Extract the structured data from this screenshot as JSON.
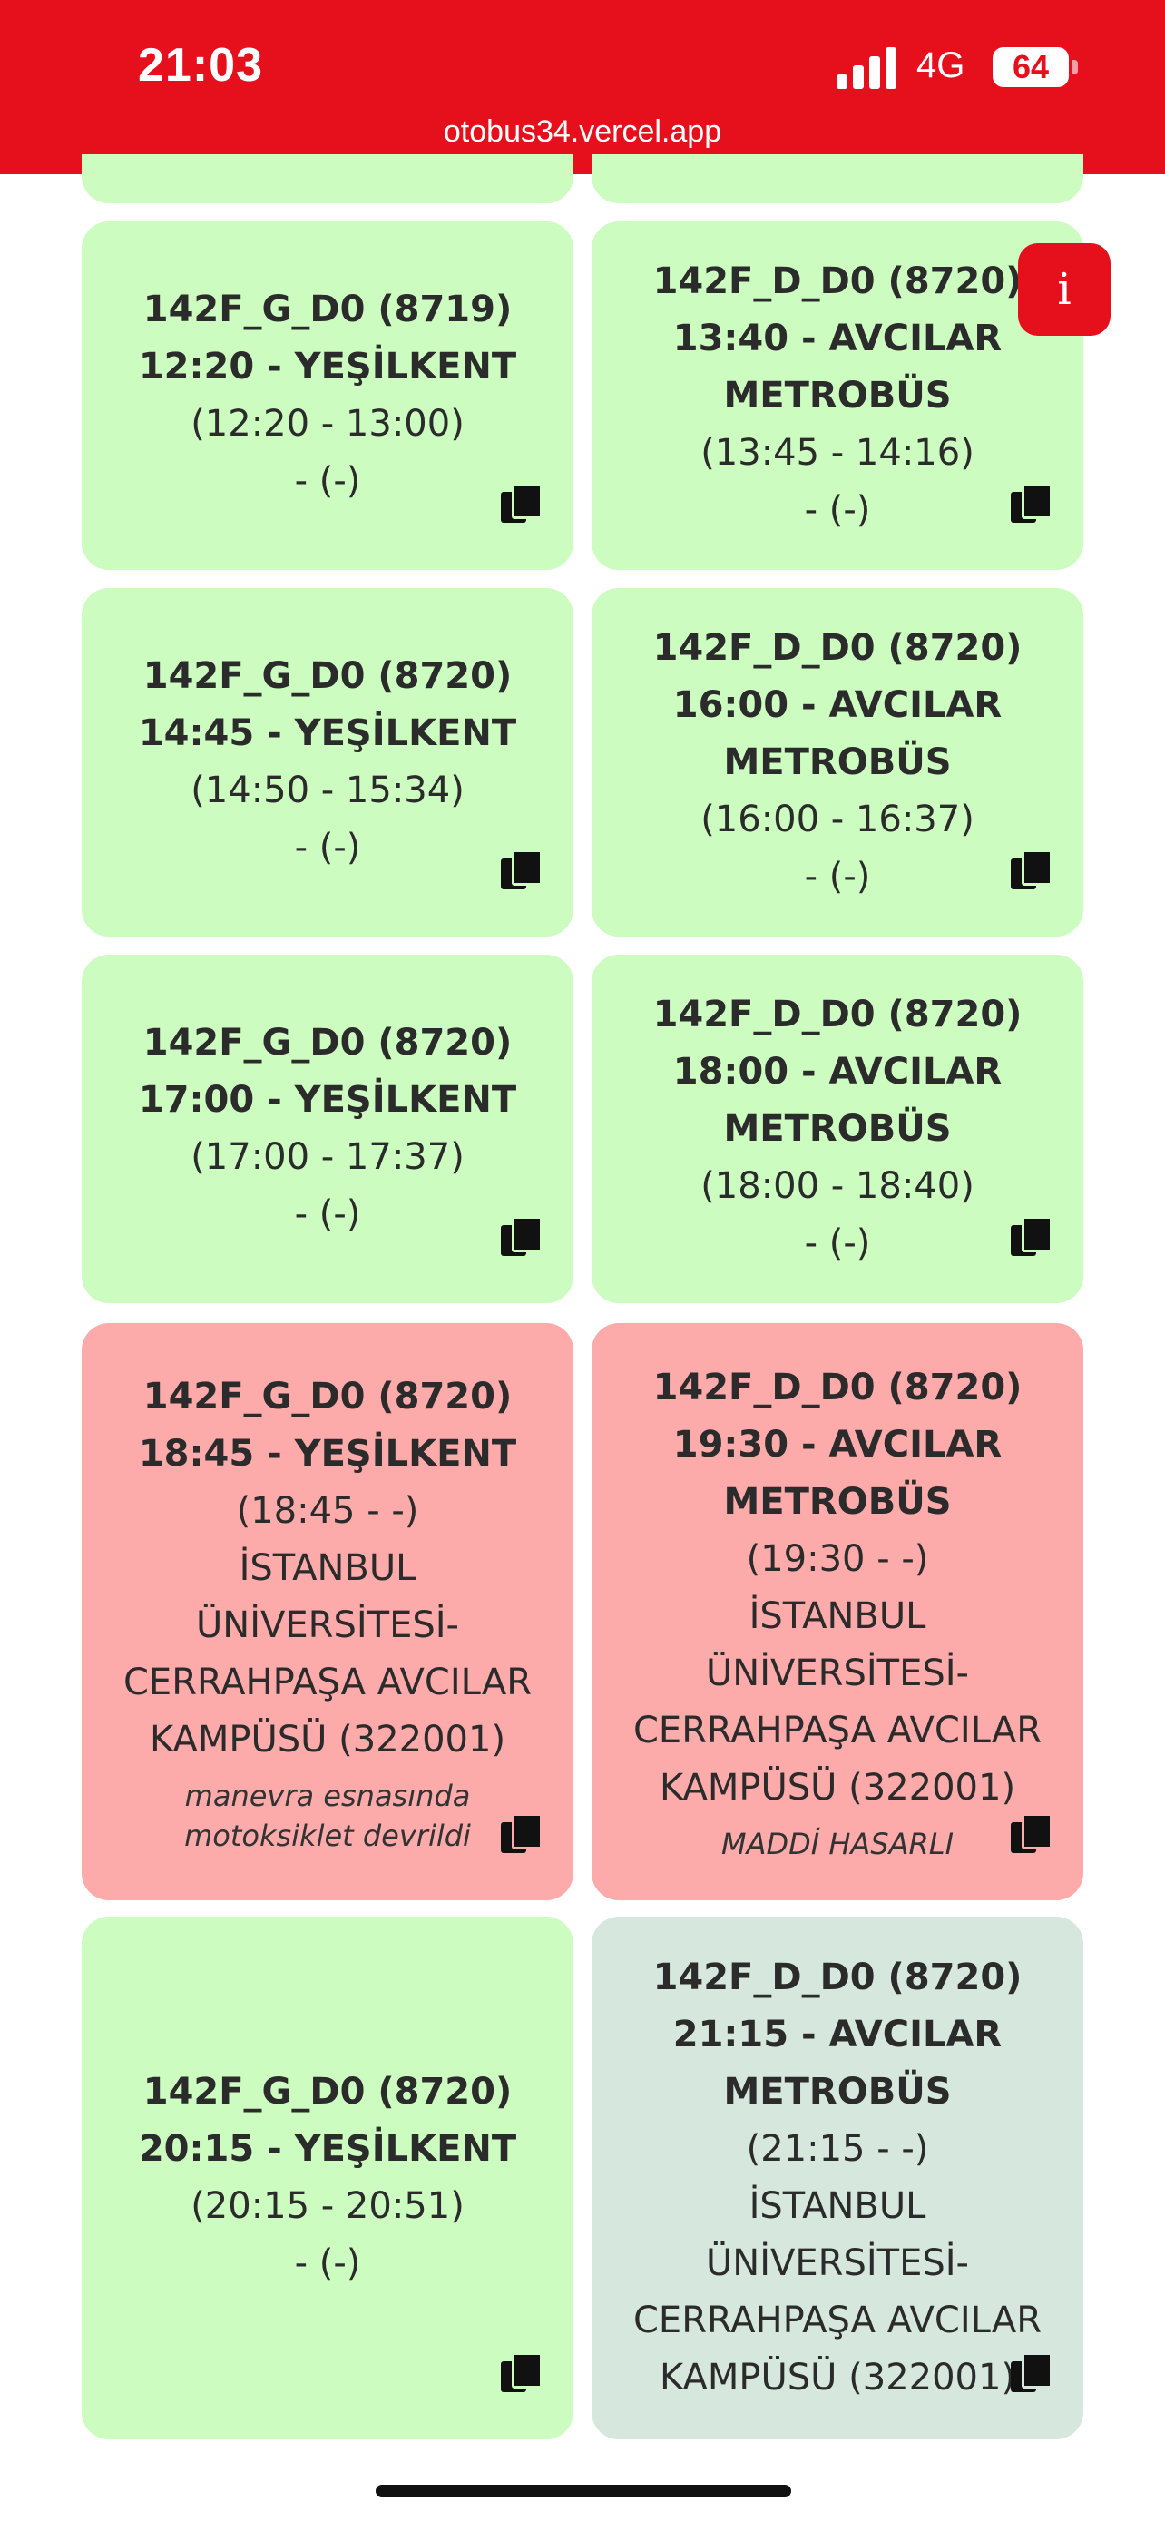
{
  "status_bar": {
    "time": "21:03",
    "network": "4G",
    "battery": "64",
    "url": "otobus34.vercel.app",
    "color": "#e6101c"
  },
  "info_button": {
    "label": "i"
  },
  "trips": [
    {
      "line1": "142F_G_D0 (8719)",
      "line2": "12:20 - YEŞİLKENT",
      "times": "(12:20 - 13:00)",
      "details": [
        "- (-)"
      ],
      "note": "",
      "status": "green"
    },
    {
      "line1": "142F_D_D0 (8720)",
      "line2": "13:40 - AVCILAR METROBÜS",
      "times": "(13:45 - 14:16)",
      "details": [
        "- (-)"
      ],
      "note": "",
      "status": "green"
    },
    {
      "line1": "142F_G_D0 (8720)",
      "line2": "14:45 - YEŞİLKENT",
      "times": "(14:50 - 15:34)",
      "details": [
        "- (-)"
      ],
      "note": "",
      "status": "green"
    },
    {
      "line1": "142F_D_D0 (8720)",
      "line2": "16:00 - AVCILAR METROBÜS",
      "times": "(16:00 - 16:37)",
      "details": [
        "- (-)"
      ],
      "note": "",
      "status": "green"
    },
    {
      "line1": "142F_G_D0 (8720)",
      "line2": "17:00 - YEŞİLKENT",
      "times": "(17:00 - 17:37)",
      "details": [
        "- (-)"
      ],
      "note": "",
      "status": "green"
    },
    {
      "line1": "142F_D_D0 (8720)",
      "line2": "18:00 - AVCILAR METROBÜS",
      "times": "(18:00 - 18:40)",
      "details": [
        "- (-)"
      ],
      "note": "",
      "status": "green"
    },
    {
      "line1": "142F_G_D0 (8720)",
      "line2": "18:45 - YEŞİLKENT",
      "times": "(18:45 - -)",
      "details": [
        "İSTANBUL ÜNİVERSİTESİ-CERRAHPAŞA AVCILAR KAMPÜSÜ (322001)"
      ],
      "note": "manevra esnasında motoksiklet devrildi",
      "status": "red"
    },
    {
      "line1": "142F_D_D0 (8720)",
      "line2": "19:30 - AVCILAR METROBÜS",
      "times": "(19:30 - -)",
      "details": [
        "İSTANBUL ÜNİVERSİTESİ-CERRAHPAŞA AVCILAR KAMPÜSÜ (322001)"
      ],
      "note": "MADDİ HASARLI",
      "status": "red"
    },
    {
      "line1": "142F_G_D0 (8720)",
      "line2": "20:15 - YEŞİLKENT",
      "times": "(20:15 - 20:51)",
      "details": [
        "- (-)"
      ],
      "note": "",
      "status": "green"
    },
    {
      "line1": "142F_D_D0 (8720)",
      "line2": "21:15 - AVCILAR METROBÜS",
      "times": "(21:15 - -)",
      "details": [
        "İSTANBUL ÜNİVERSİTESİ-CERRAHPAŞA AVCILAR KAMPÜSÜ (322001)"
      ],
      "note": "",
      "status": "gray"
    }
  ],
  "colors": {
    "green": "#ccfcc0",
    "red": "#fdaaaa",
    "gray": "#d6e8dd"
  },
  "icons": {
    "copy": "copy-icon",
    "signal": "signal-icon",
    "battery": "battery-icon"
  }
}
